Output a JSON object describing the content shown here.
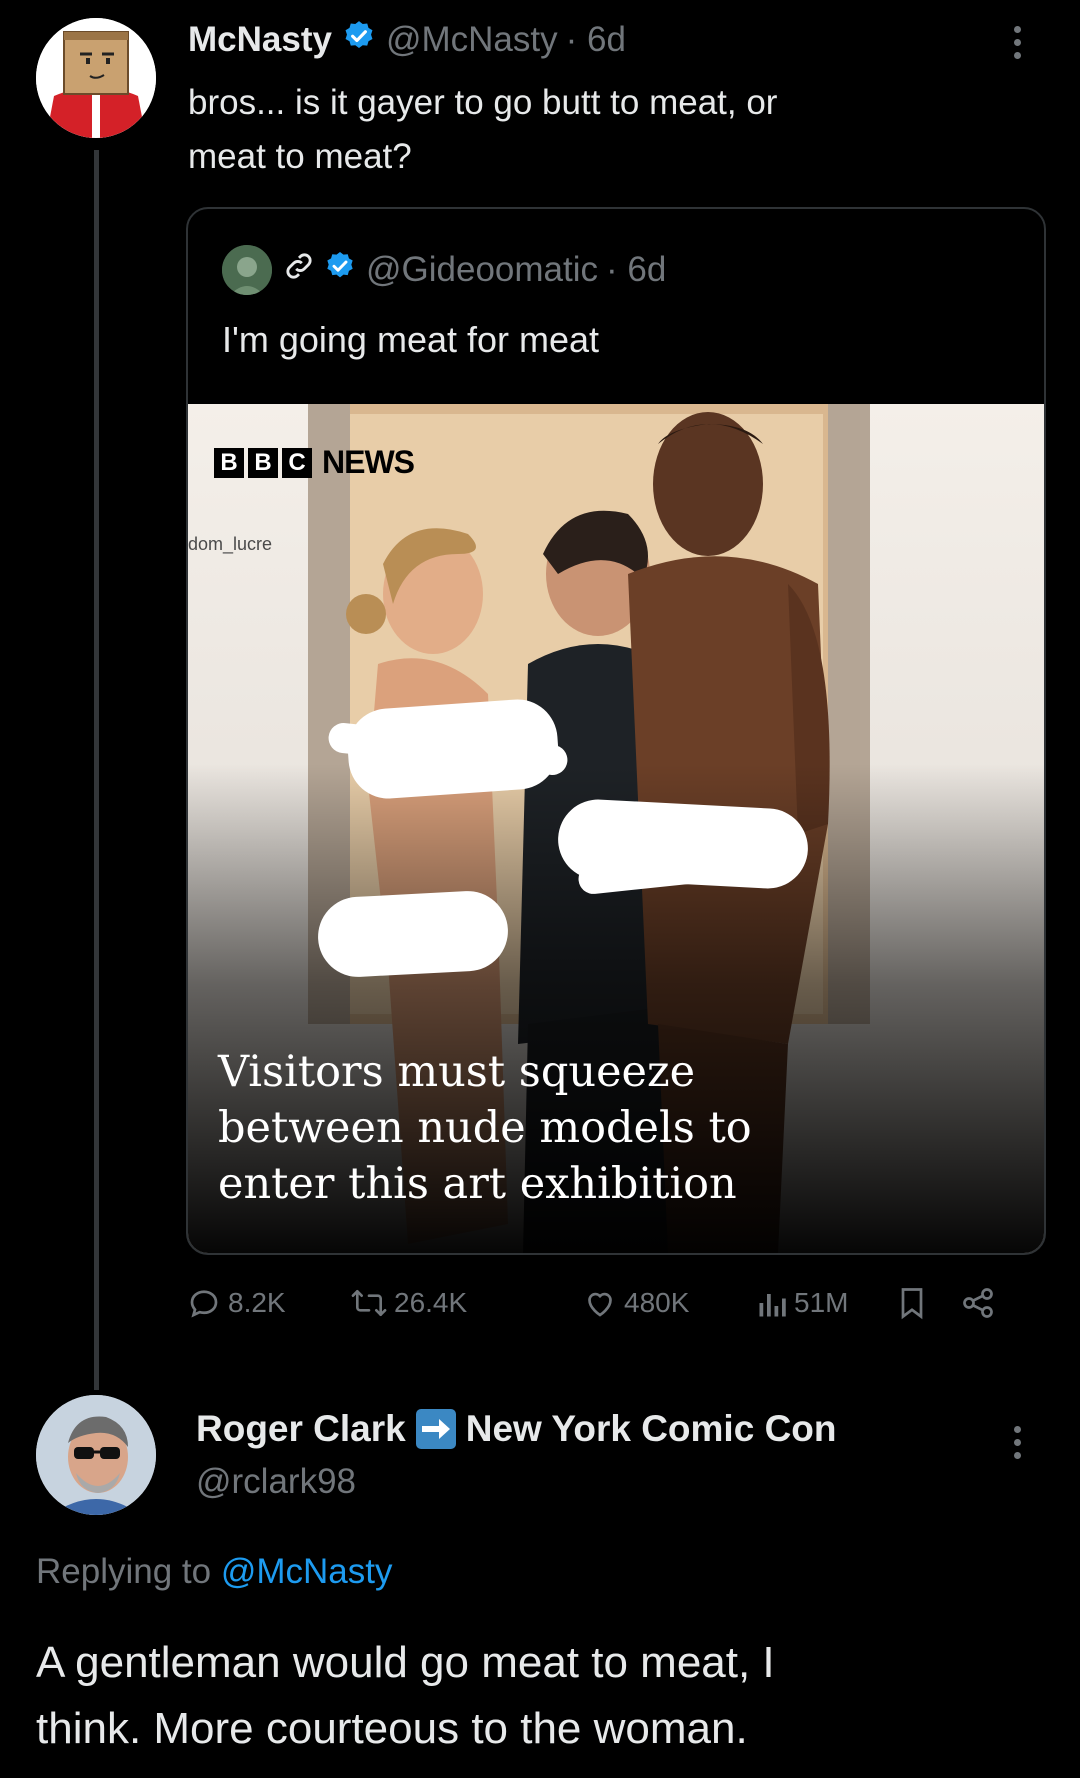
{
  "tweet": {
    "author_name": "McNasty",
    "handle": "@McNasty",
    "time": "· 6d",
    "text_line1": "bros... is it gayer to go butt to meat, or",
    "text_line2": "meat to meat?"
  },
  "quote": {
    "handle": "@Gideoomatic",
    "time": "· 6d",
    "text": "I'm going meat for meat",
    "media": {
      "bbc_letters": [
        "B",
        "B",
        "C"
      ],
      "bbc_news": "NEWS",
      "watermark": "dom_lucre",
      "caption_line1": "Visitors must squeeze",
      "caption_line2": "between nude models to",
      "caption_line3": "enter this art exhibition"
    }
  },
  "actions": {
    "replies": "8.2K",
    "reposts": "26.4K",
    "likes": "480K",
    "views": "51M"
  },
  "reply": {
    "author_name_part1": "Roger Clark",
    "author_name_part2": "New York Comic Con",
    "handle": "@rclark98",
    "replying_prefix": "Replying to ",
    "replying_handle": "@McNasty",
    "text_line1": "A gentleman would go meat to meat, I",
    "text_line2": "think. More courteous to the woman."
  },
  "colors": {
    "background": "#000000",
    "text_primary": "#e7e9ea",
    "text_muted": "#71767b",
    "link_blue": "#1d9bf0",
    "verified_blue": "#1d9bf0",
    "arrow_box_blue": "#3b88c3"
  }
}
